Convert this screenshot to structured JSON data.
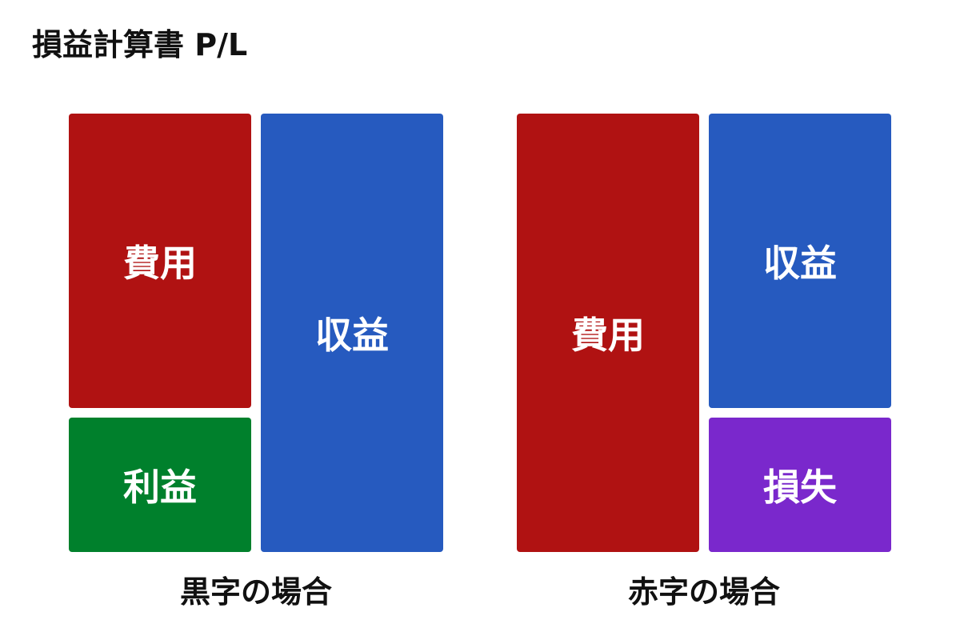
{
  "title": "損益計算書 P/L",
  "colors": {
    "expense": "#B01212",
    "revenue": "#265ABF",
    "profit": "#00802C",
    "loss": "#7A28CC"
  },
  "profit_case": {
    "caption": "黒字の場合",
    "expense_label": "費用",
    "profit_label": "利益",
    "revenue_label": "収益"
  },
  "loss_case": {
    "caption": "赤字の場合",
    "expense_label": "費用",
    "revenue_label": "収益",
    "loss_label": "損失"
  }
}
